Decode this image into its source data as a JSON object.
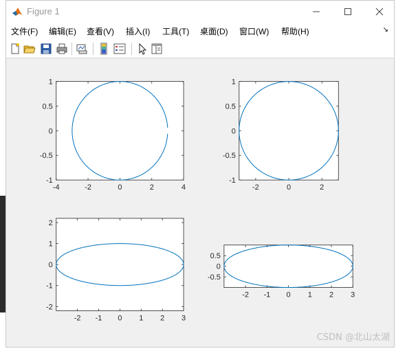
{
  "window": {
    "title": "Figure 1",
    "icon": "matlab-logo-icon"
  },
  "controls": {
    "minimize": "minimize-icon",
    "maximize": "maximize-icon",
    "close": "close-icon"
  },
  "menubar": {
    "items": [
      "文件(F)",
      "编辑(E)",
      "查看(V)",
      "插入(I)",
      "工具(T)",
      "桌面(D)",
      "窗口(W)",
      "帮助(H)"
    ],
    "overflow_icon": "menu-overflow-icon"
  },
  "toolbar": {
    "buttons": [
      "new-figure-icon",
      "open-file-icon",
      "save-icon",
      "print-icon",
      "link-plot-icon",
      "insert-colorbar-icon",
      "insert-legend-icon",
      "edit-plot-cursor-icon",
      "property-inspector-icon"
    ]
  },
  "chart_data": [
    {
      "type": "line",
      "series": [
        {
          "description": "circle of radius 3 centred at origin, gap at angle 0",
          "x_center": 0,
          "y_center": 0,
          "rx": 3,
          "ry": 1,
          "open_gap": true
        }
      ],
      "xlim": [
        -4,
        4
      ],
      "ylim": [
        -1,
        1
      ],
      "xticks": [
        "-4",
        "-2",
        "0",
        "2",
        "4"
      ],
      "yticks": [
        "-1",
        "-0.5",
        "0",
        "0.5",
        "1"
      ],
      "color": "#0072bd"
    },
    {
      "type": "line",
      "series": [
        {
          "x_center": 0,
          "y_center": 0,
          "rx": 3,
          "ry": 1,
          "open_gap": false
        }
      ],
      "xlim": [
        -3,
        3
      ],
      "ylim": [
        -1,
        1
      ],
      "xticks": [
        "-2",
        "0",
        "2"
      ],
      "yticks": [
        "-1",
        "-0.5",
        "0",
        "0.5",
        "1"
      ],
      "color": "#0072bd"
    },
    {
      "type": "line",
      "series": [
        {
          "x_center": 0,
          "y_center": 0,
          "rx": 3,
          "ry": 1,
          "open_gap": false
        }
      ],
      "xlim": [
        -3,
        3
      ],
      "ylim": [
        -2.2,
        2.2
      ],
      "xticks": [
        "-2",
        "-1",
        "0",
        "1",
        "2",
        "3"
      ],
      "yticks": [
        "-2",
        "-1",
        "0",
        "1",
        "2"
      ],
      "color": "#0072bd"
    },
    {
      "type": "line",
      "series": [
        {
          "x_center": 0,
          "y_center": 0,
          "rx": 3,
          "ry": 1,
          "open_gap": false
        }
      ],
      "xlim": [
        -3,
        3
      ],
      "ylim": [
        -1,
        1
      ],
      "xticks": [
        "-2",
        "-1",
        "0",
        "1",
        "2",
        "3"
      ],
      "yticks": [
        "-0.5",
        "0",
        "0.5"
      ],
      "color": "#0072bd"
    }
  ],
  "watermark": "CSDN @北山太湖"
}
